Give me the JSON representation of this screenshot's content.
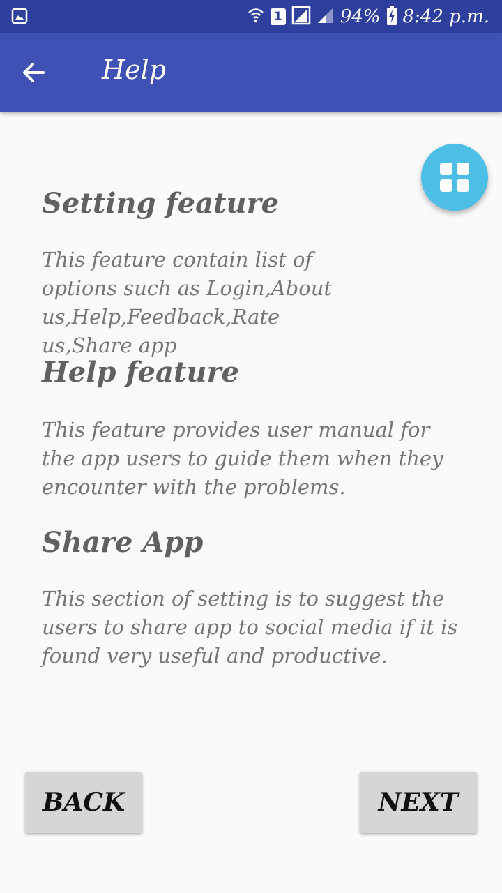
{
  "status_bar": {
    "sim": "1",
    "battery": "94%",
    "time": "8:42 p.m."
  },
  "app_bar": {
    "title": "Help"
  },
  "sections": [
    {
      "heading": "Setting feature",
      "body": "This feature contain list of options such as Login,About us,Help,Feedback,Rate us,Share app"
    },
    {
      "heading": "Help feature",
      "body": "This feature provides user manual for the app users to guide them when they encounter with the problems."
    },
    {
      "heading": "Share App",
      "body": "This section of setting is to suggest the users to share app to social media if it is found very useful and productive."
    }
  ],
  "buttons": {
    "back": "BACK",
    "next": "NEXT"
  },
  "colors": {
    "status_bar": "#2f3f9e",
    "app_bar": "#3f51b5",
    "fab": "#4dbfe6",
    "button": "#d6d6d6"
  }
}
